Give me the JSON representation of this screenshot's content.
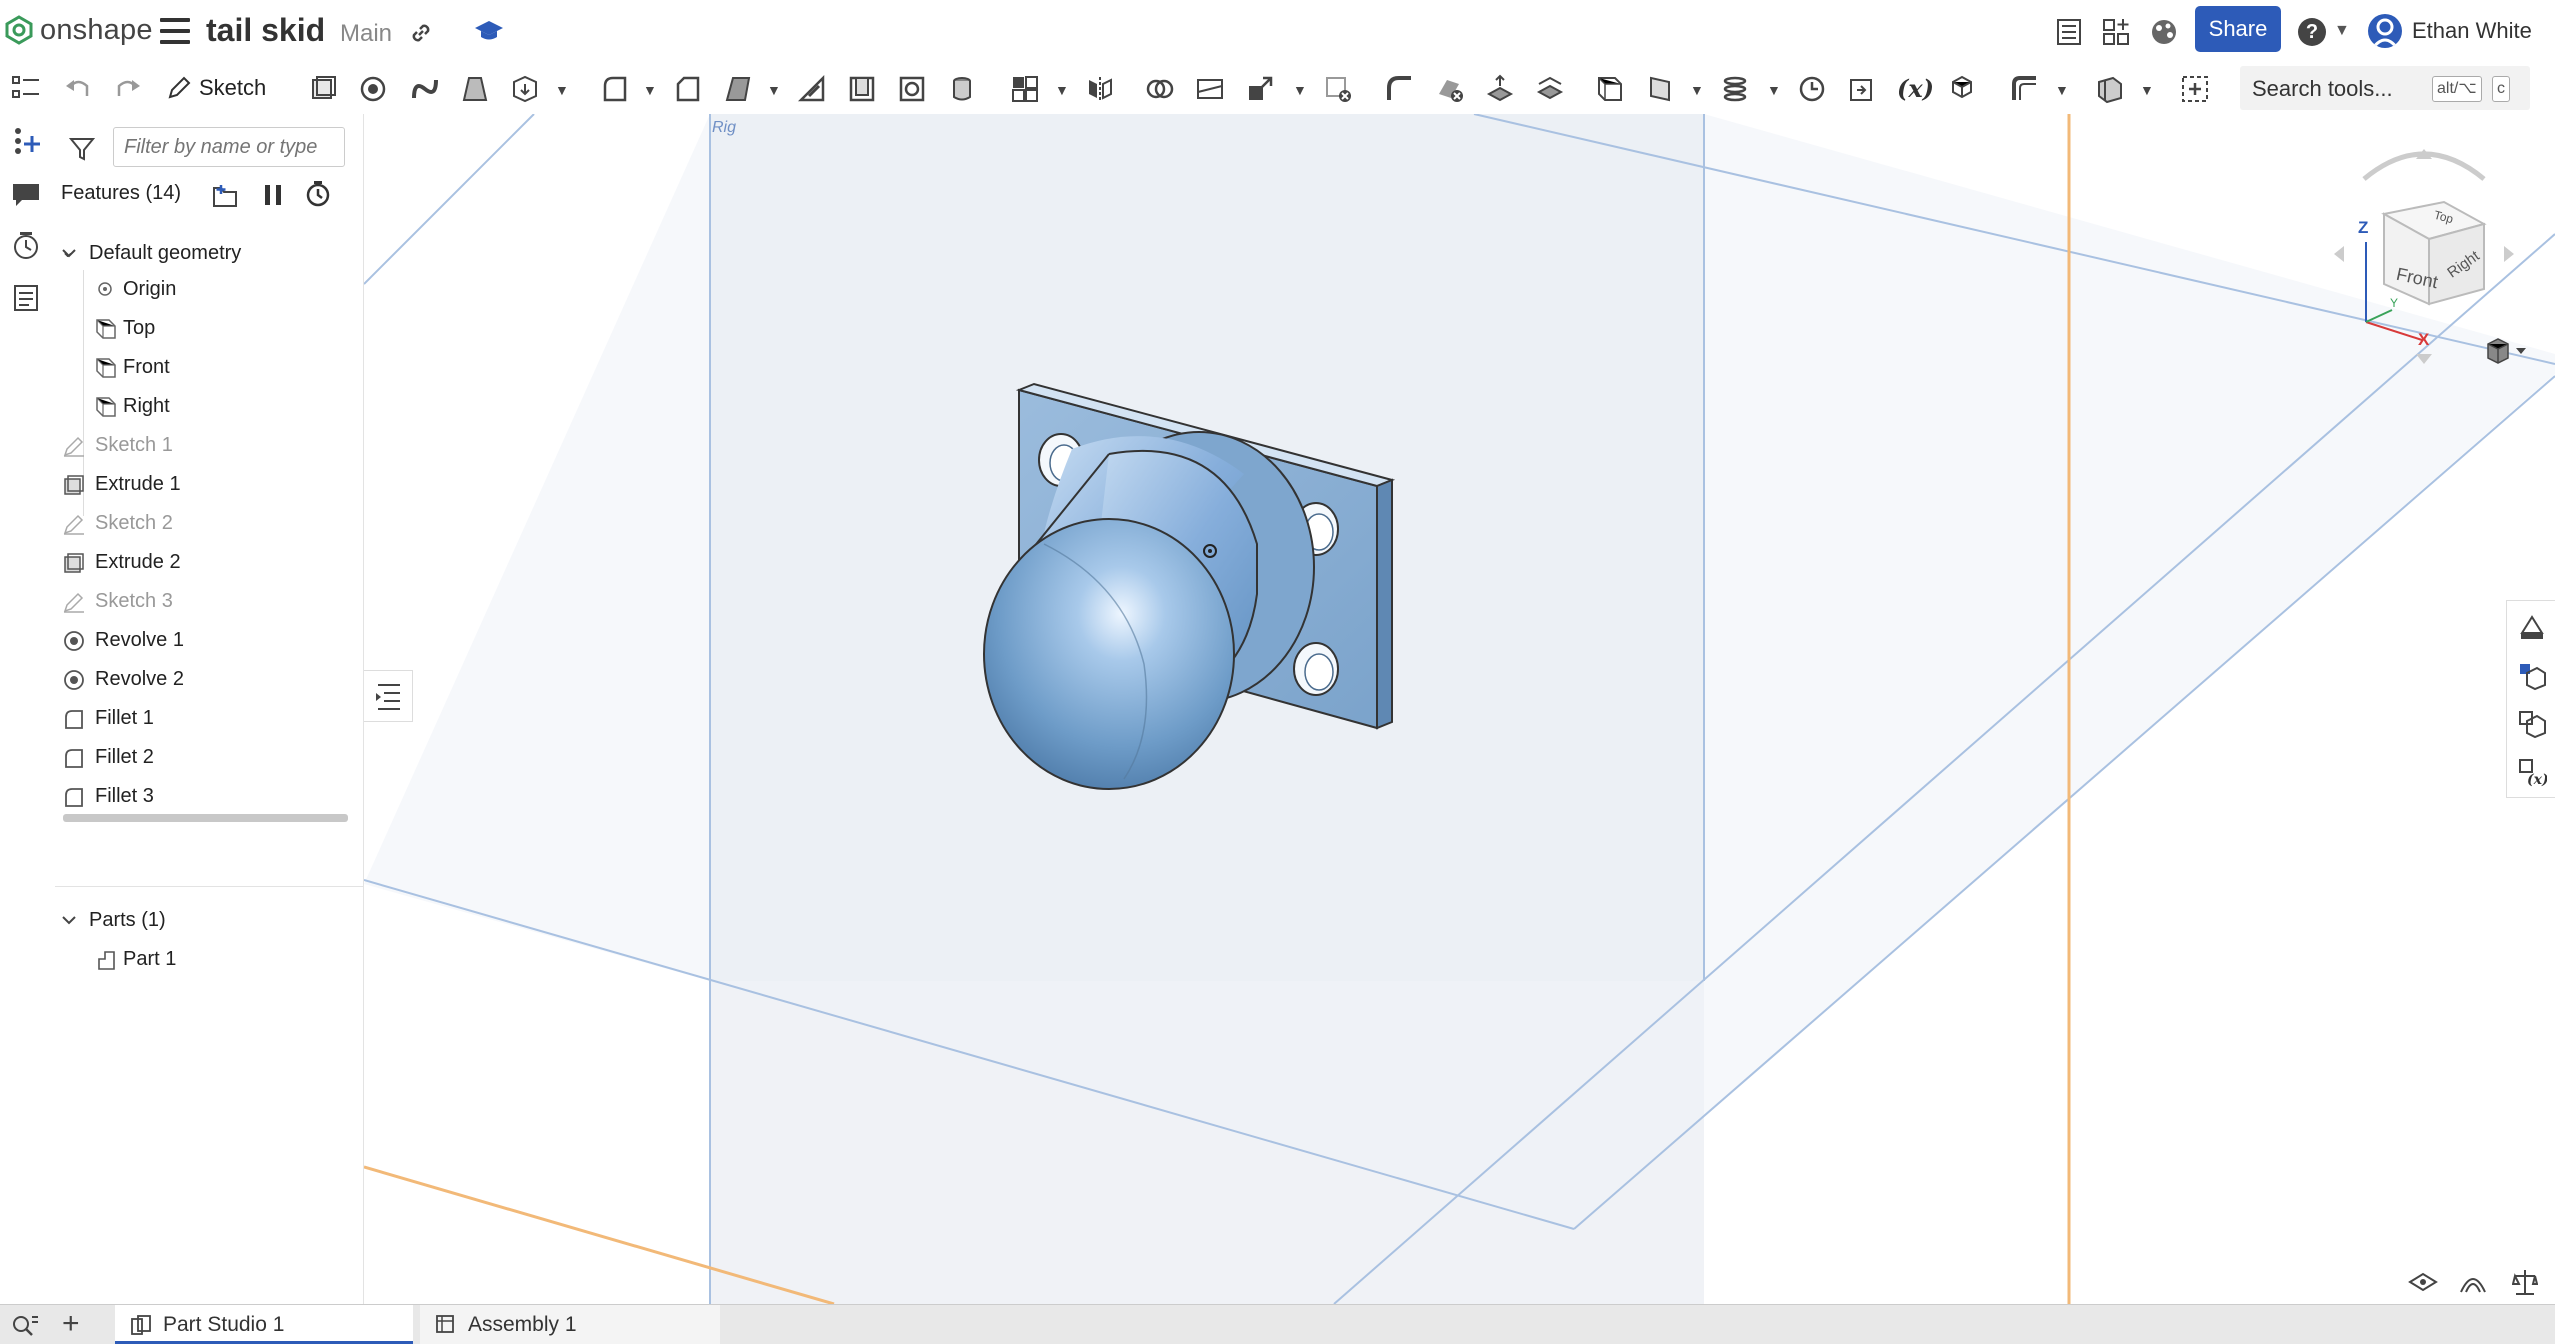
{
  "app": {
    "brand": "onshape",
    "accent_color": "#2d5bb8"
  },
  "document": {
    "title": "tail skid",
    "branch": "Main"
  },
  "header": {
    "share_label": "Share",
    "help_label": "?",
    "user_name": "Ethan White",
    "icons": [
      "workspace-info-icon",
      "app-store-icon",
      "render-studio-icon",
      "help-icon",
      "user-avatar-icon"
    ]
  },
  "toolbar": {
    "sketch_label": "Sketch",
    "search_label": "Search tools...",
    "search_shortcut_1": "alt/⌥",
    "search_shortcut_2": "c",
    "variable_label": "(x)"
  },
  "feature_panel": {
    "filter_placeholder": "Filter by name or type",
    "features_title": "Features (14)",
    "default_geometry": "Default geometry",
    "origin": "Origin",
    "planes": [
      "Top",
      "Front",
      "Right"
    ],
    "features": [
      {
        "label": "Sketch 1",
        "type": "sketch",
        "dim": true
      },
      {
        "label": "Extrude 1",
        "type": "extrude",
        "dim": false
      },
      {
        "label": "Sketch 2",
        "type": "sketch",
        "dim": true
      },
      {
        "label": "Extrude 2",
        "type": "extrude",
        "dim": false
      },
      {
        "label": "Sketch 3",
        "type": "sketch",
        "dim": true
      },
      {
        "label": "Revolve 1",
        "type": "revolve",
        "dim": false
      },
      {
        "label": "Revolve 2",
        "type": "revolve",
        "dim": false
      },
      {
        "label": "Fillet 1",
        "type": "fillet",
        "dim": false
      },
      {
        "label": "Fillet 2",
        "type": "fillet",
        "dim": false
      },
      {
        "label": "Fillet 3",
        "type": "fillet",
        "dim": false
      }
    ],
    "parts_title": "Parts (1)",
    "parts": [
      "Part 1"
    ]
  },
  "viewcube": {
    "front": "Front",
    "top": "Top",
    "right": "Right",
    "axis_x": "X",
    "axis_y": "Y",
    "axis_z": "Z"
  },
  "viewport": {
    "plane_label": "Right"
  },
  "tabs": [
    {
      "label": "Part Studio 1",
      "active": true
    },
    {
      "label": "Assembly 1",
      "active": false
    }
  ],
  "add_tab_label": "+"
}
